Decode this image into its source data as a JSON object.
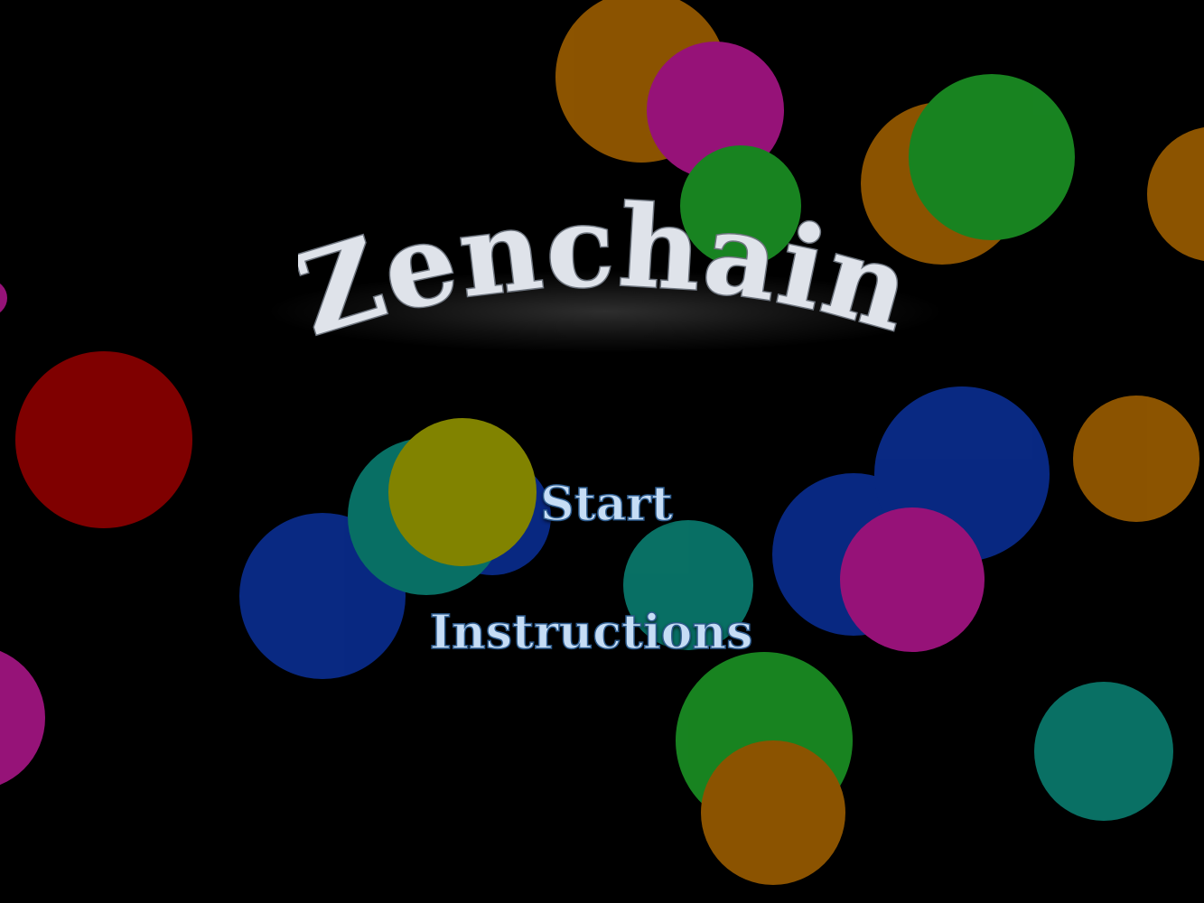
{
  "game": {
    "title": "Zenchain"
  },
  "menu": {
    "start_label": "Start",
    "instructions_label": "Instructions"
  },
  "colors": {
    "background": "#000000",
    "title_fill": "#dfe3ea",
    "menu_text": "#c6ddf5",
    "bubble_orange": "#b36b00",
    "bubble_magenta": "#c0189a",
    "bubble_green": "#1fa82a",
    "bubble_red": "#8b0000",
    "bubble_blue": "#0b34a6",
    "bubble_teal": "#0b8f80",
    "bubble_yellow": "#a6a800"
  }
}
